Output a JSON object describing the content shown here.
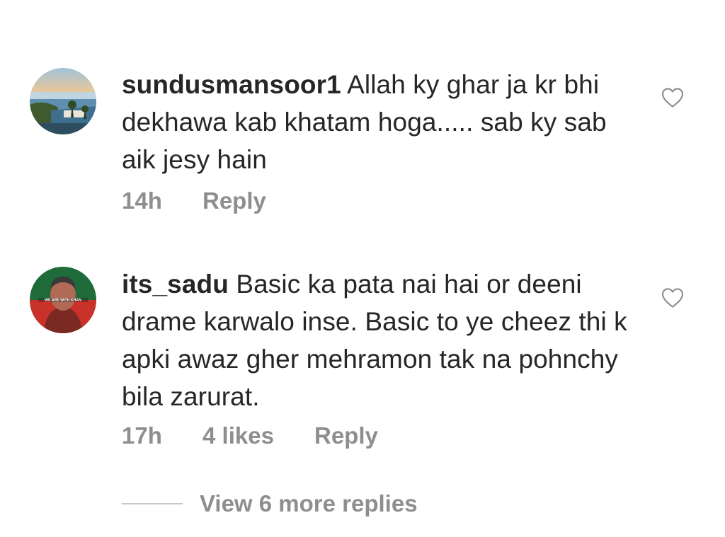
{
  "comments": [
    {
      "username": "sundusmansoor1",
      "text": "Allah ky ghar ja kr bhi dekhawa kab khatam hoga..... sab ky sab aik jesy hain",
      "time": "14h",
      "likes": "",
      "reply_label": "Reply",
      "avatar_icon": "avatar-landscape-photo",
      "like_icon": "heart-outline-icon"
    },
    {
      "username": "its_sadu",
      "text": "Basic ka pata nai hai or deeni drame karwalo inse. Basic to ye cheez thi k apki awaz gher mehramon tak na pohnchy bila zarurat.",
      "time": "17h",
      "likes": "4 likes",
      "reply_label": "Reply",
      "avatar_icon": "avatar-portrait-photo",
      "avatar_caption": "WE ARE WITH KHAN",
      "like_icon": "heart-outline-icon"
    }
  ],
  "view_more_replies": "View 6 more replies",
  "colors": {
    "text": "#262626",
    "secondary": "#8e8e8e",
    "divider": "#c7c7c7",
    "background": "#ffffff"
  }
}
